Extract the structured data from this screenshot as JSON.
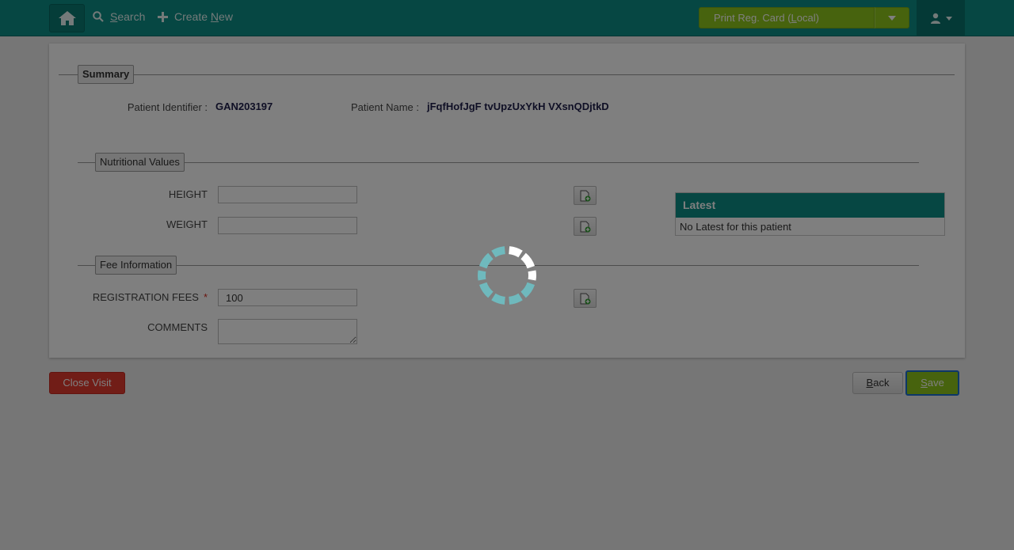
{
  "topbar": {
    "search_prefix": "",
    "search_underlined": "S",
    "search_rest": "earch",
    "create_prefix": "Create ",
    "create_underlined": "N",
    "create_rest": "ew",
    "print_prefix": "Print Reg. Card (",
    "print_underlined": "L",
    "print_rest": "ocal)"
  },
  "summary": {
    "legend": "Summary",
    "patient_identifier_label": "Patient Identifier :",
    "patient_identifier_value": "GAN203197",
    "patient_name_label": "Patient Name :",
    "patient_name_value": "jFqfHofJgF tvUpzUxYkH VXsnQDjtkD"
  },
  "nutritional": {
    "legend": "Nutritional Values",
    "height_label": "HEIGHT",
    "height_value": "",
    "weight_label": "WEIGHT",
    "weight_value": ""
  },
  "fee": {
    "legend": "Fee Information",
    "registration_label": "REGISTRATION FEES",
    "required_marker": "*",
    "registration_value": "100",
    "comments_label": "COMMENTS",
    "comments_value": ""
  },
  "latest": {
    "title": "Latest",
    "message": "No Latest for this patient"
  },
  "actions": {
    "close_visit": "Close Visit",
    "back_underlined": "B",
    "back_rest": "ack",
    "save_underlined": "S",
    "save_rest": "ave"
  },
  "colors": {
    "brand": "#0d8f87",
    "primary_action": "#8fc61c",
    "danger": "#e33a2f"
  },
  "icons": {
    "home": "home-icon",
    "search": "search-icon",
    "create": "plus-icon",
    "caret": "chevron-down-icon",
    "user": "user-icon",
    "add_observation": "document-add-icon",
    "spinner": "loading-spinner-icon"
  }
}
